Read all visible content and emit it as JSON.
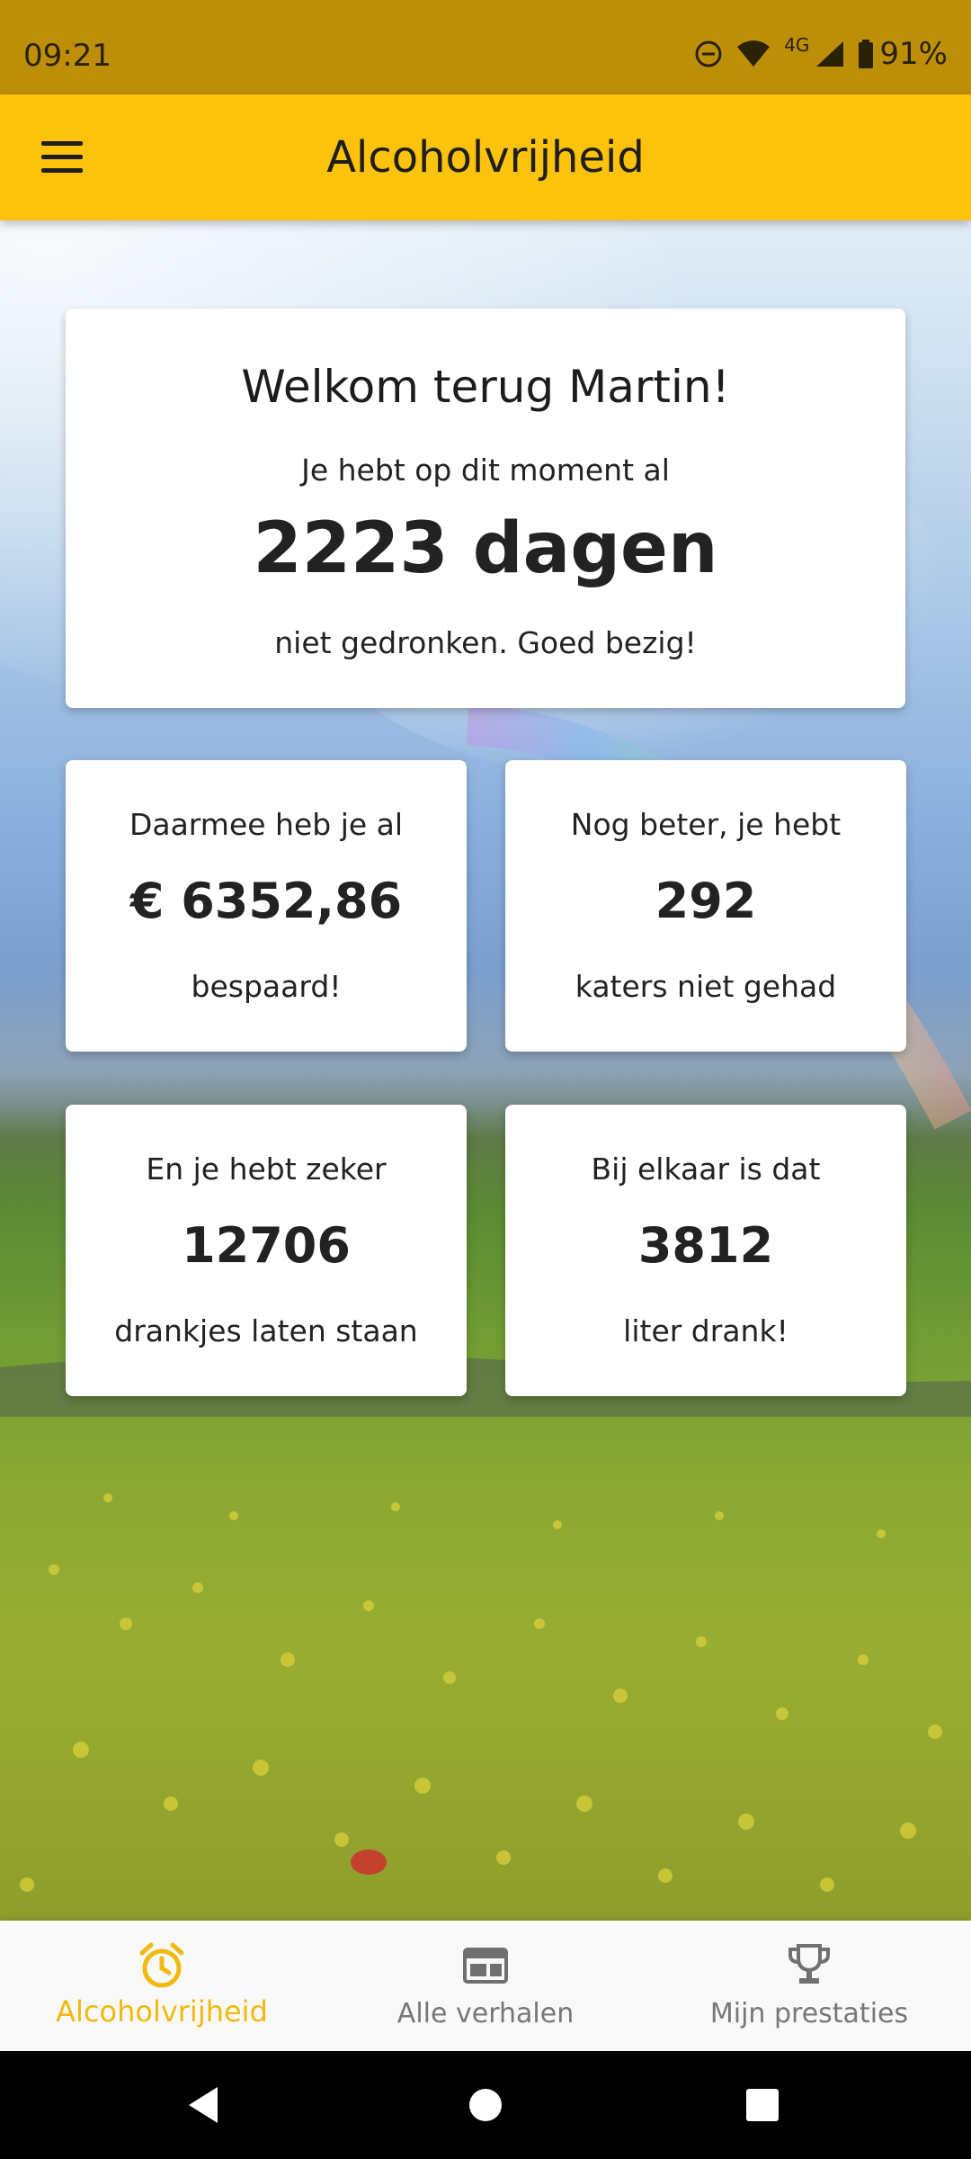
{
  "status_bar": {
    "time": "09:21",
    "network": "4G",
    "battery": "91%",
    "icons": [
      "do-not-disturb-icon",
      "wifi-icon",
      "signal-icon",
      "battery-icon"
    ]
  },
  "app_bar": {
    "title": "Alcoholvrijheid",
    "menu_icon": "menu-icon"
  },
  "welcome_card": {
    "title": "Welkom terug Martin!",
    "intro": "Je hebt op dit moment al",
    "value": "2223 dagen",
    "outro": "niet gedronken. Goed bezig!"
  },
  "stats": [
    {
      "top": "Daarmee heb je al",
      "value": "€ 6352,86",
      "bottom": "bespaard!"
    },
    {
      "top": "Nog beter, je hebt",
      "value": "292",
      "bottom": "katers niet gehad"
    },
    {
      "top": "En je hebt zeker",
      "value": "12706",
      "bottom": "drankjes laten staan"
    },
    {
      "top": "Bij elkaar is dat",
      "value": "3812",
      "bottom": "liter drank!"
    }
  ],
  "bottom_nav": {
    "items": [
      {
        "label": "Alcoholvrijheid",
        "icon": "alarm-clock-icon",
        "active": true
      },
      {
        "label": "Alle verhalen",
        "icon": "web-page-icon",
        "active": false
      },
      {
        "label": "Mijn prestaties",
        "icon": "trophy-icon",
        "active": false
      }
    ]
  },
  "colors": {
    "status_bar": "#bd8f08",
    "app_bar": "#fcc20c",
    "active_accent": "#f3b90f",
    "inactive_nav": "#777777"
  }
}
